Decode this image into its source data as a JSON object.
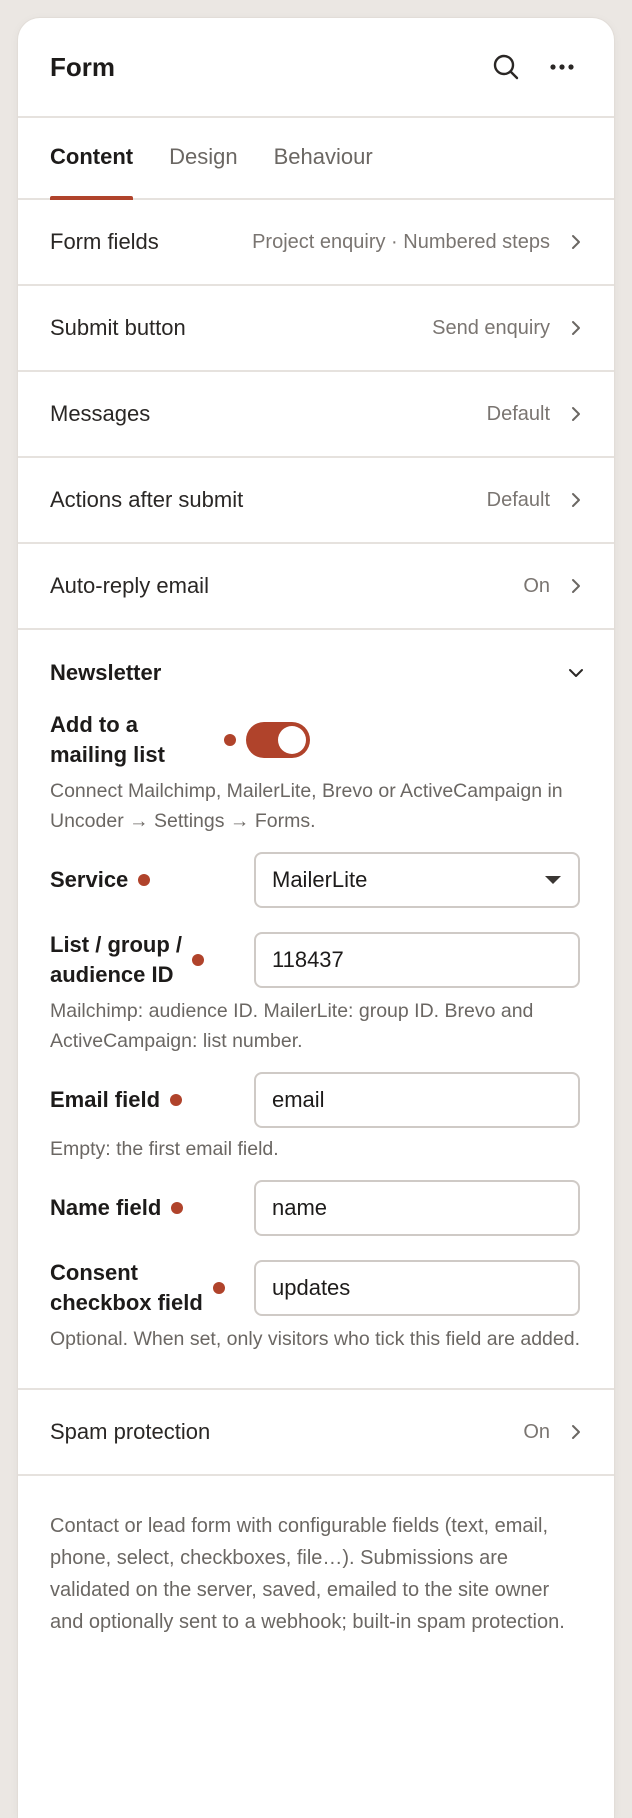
{
  "header": {
    "title": "Form"
  },
  "tabs": [
    {
      "label": "Content",
      "active": true
    },
    {
      "label": "Design",
      "active": false
    },
    {
      "label": "Behaviour",
      "active": false
    }
  ],
  "rows": {
    "form_fields": {
      "label": "Form fields",
      "value": "Project enquiry · Numbered steps"
    },
    "submit_button": {
      "label": "Submit button",
      "value": "Send enquiry"
    },
    "messages": {
      "label": "Messages",
      "value": "Default"
    },
    "actions_after_submit": {
      "label": "Actions after submit",
      "value": "Default"
    },
    "auto_reply": {
      "label": "Auto-reply email",
      "value": "On"
    },
    "spam_protection": {
      "label": "Spam protection",
      "value": "On"
    }
  },
  "newsletter": {
    "title": "Newsletter",
    "add_to_list": {
      "label_line1": "Add to a",
      "label_line2": "mailing list",
      "enabled": true
    },
    "add_help": "Connect Mailchimp, MailerLite, Brevo or ActiveCampaign in Uncoder → Settings → Forms.",
    "service": {
      "label": "Service",
      "value": "MailerLite"
    },
    "list_id": {
      "label_line1": "List / group /",
      "label_line2": "audience ID",
      "value": "118437"
    },
    "list_help": "Mailchimp: audience ID. MailerLite: group ID. Brevo and ActiveCampaign: list number.",
    "email_field": {
      "label": "Email field",
      "value": "email"
    },
    "email_help": "Empty: the first email field.",
    "name_field": {
      "label": "Name field",
      "value": "name"
    },
    "consent_field": {
      "label_line1": "Consent",
      "label_line2": "checkbox field",
      "value": "updates"
    },
    "consent_help": "Optional. When set, only visitors who tick this field are added."
  },
  "description": "Contact or lead form with configurable fields (text, email, phone, select, checkboxes, file…). Submissions are validated on the server, saved, emailed to the site owner and optionally sent to a webhook; built-in spam protection.",
  "colors": {
    "accent": "#b0432b",
    "border": "#e6e2de",
    "muted_text": "#6b6763"
  }
}
